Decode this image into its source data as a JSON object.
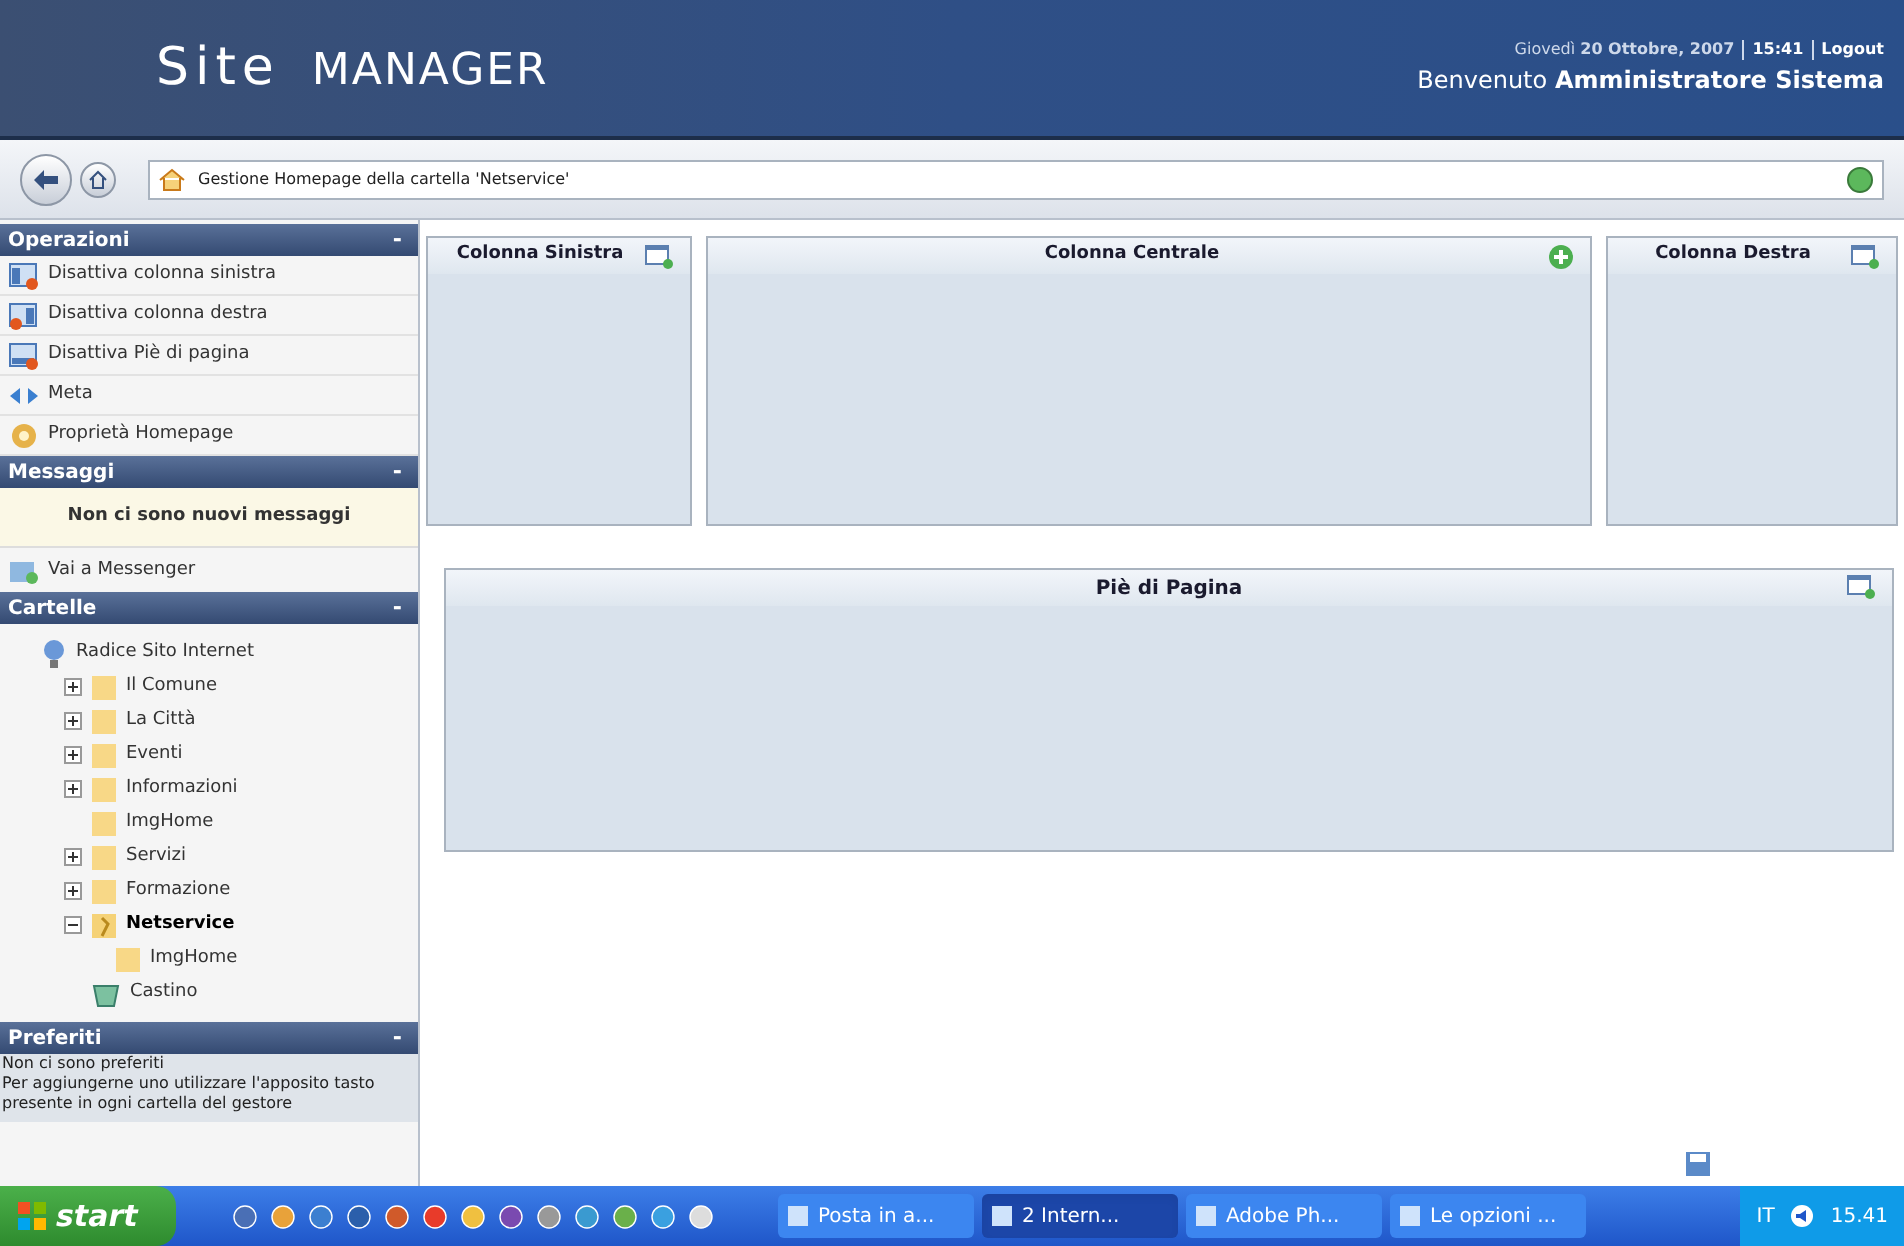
{
  "header": {
    "logo_word1": "Site",
    "logo_word2": "MANAGER",
    "date_prefix": "Giovedì",
    "date": "20 Ottobre, 2007",
    "time": "15:41",
    "logout": "Logout",
    "welcome": "Benvenuto",
    "user": "Amministratore Sistema"
  },
  "breadcrumb": {
    "text": "Gestione Homepage della cartella 'Netservice'"
  },
  "sidebar": {
    "operations": {
      "title": "Operazioni",
      "toggle": "-",
      "items": [
        {
          "label": "Disattiva colonna sinistra",
          "kind": "left"
        },
        {
          "label": "Disattiva colonna destra",
          "kind": "right"
        },
        {
          "label": "Disattiva Piè di pagina",
          "kind": "footer"
        },
        {
          "label": "Meta",
          "kind": "meta"
        },
        {
          "label": "Proprietà Homepage",
          "kind": "props"
        }
      ]
    },
    "messages": {
      "title": "Messaggi",
      "toggle": "-",
      "notice": "Non ci sono nuovi messaggi",
      "link": "Vai a Messenger"
    },
    "folders": {
      "title": "Cartelle",
      "toggle": "-",
      "tree": [
        {
          "label": "Radice Sito Internet",
          "kind": "root",
          "selected": false,
          "children": [
            {
              "label": "Il Comune",
              "kind": "folder",
              "selected": false,
              "expanded": false
            },
            {
              "label": "La Città",
              "kind": "folder",
              "selected": false,
              "expanded": false
            },
            {
              "label": "Eventi",
              "kind": "folder",
              "selected": false,
              "expanded": false
            },
            {
              "label": "Informazioni",
              "kind": "folder",
              "selected": false,
              "expanded": false
            },
            {
              "label": "ImgHome",
              "kind": "folder",
              "selected": false
            },
            {
              "label": "Servizi",
              "kind": "folder",
              "selected": false,
              "expanded": false
            },
            {
              "label": "Formazione",
              "kind": "folder",
              "selected": false,
              "expanded": false
            },
            {
              "label": "Netservice",
              "kind": "open-folder",
              "selected": true,
              "expanded": true,
              "children": [
                {
                  "label": "ImgHome",
                  "kind": "folder",
                  "selected": false
                }
              ]
            },
            {
              "label": "Castino",
              "kind": "trash",
              "selected": false
            }
          ]
        }
      ]
    },
    "favorites": {
      "title": "Preferiti",
      "toggle": "-",
      "lines": [
        "Non ci sono preferiti",
        "Per aggiungerne uno utilizzare l'apposito tasto presente in ogni cartella del gestore"
      ]
    }
  },
  "columns": [
    {
      "title": "Colonna Sinistra",
      "kind": "window"
    },
    {
      "title": "Colonna Centrale",
      "kind": "add"
    },
    {
      "title": "Colonna Destra",
      "kind": "window"
    }
  ],
  "footer_panel": {
    "title": "Piè di Pagina"
  },
  "taskbar": {
    "start": "start",
    "tasks": [
      {
        "label": "Posta in a...",
        "selected": false
      },
      {
        "label": "2 Intern...",
        "selected": true
      },
      {
        "label": "Adobe Ph...",
        "selected": false
      },
      {
        "label": "Le opzioni ...",
        "selected": false
      }
    ],
    "language": "IT",
    "clock": "15.41"
  }
}
